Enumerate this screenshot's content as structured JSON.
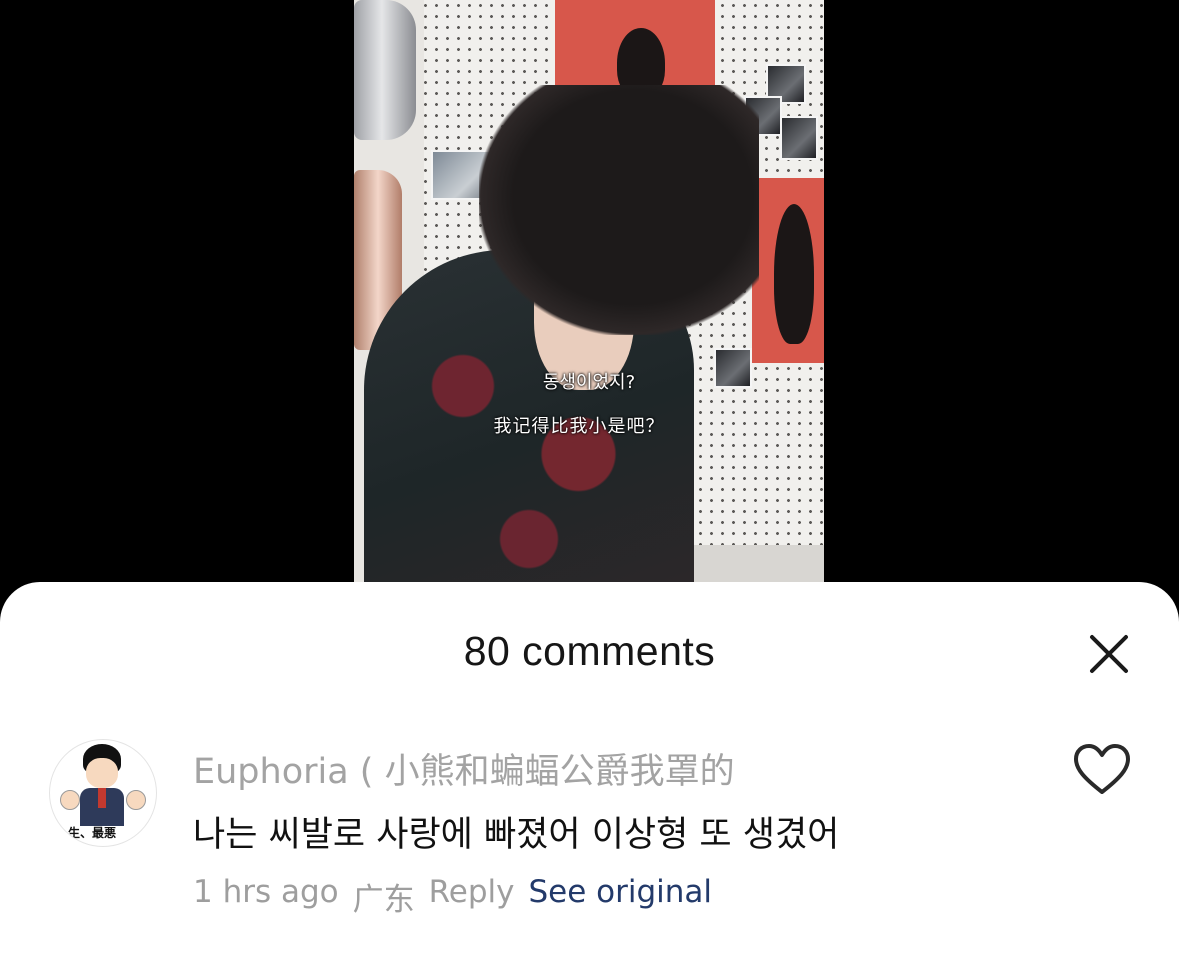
{
  "video": {
    "subtitle_korean": "동생이었지?",
    "subtitle_chinese": "我记得比我小是吧？"
  },
  "comments_sheet": {
    "title": "80 comments",
    "close_icon": "close-icon"
  },
  "comment": {
    "avatar_caption": "生、最悪",
    "username": "Euphoria ( 小熊和蝙蝠公爵我罩的",
    "text": "나는 씨발로 사랑에 빠졌어 이상형 또 생겼어",
    "time": "1 hrs ago",
    "location": "广东",
    "reply_label": "Reply",
    "see_original_label": "See original",
    "like_icon": "heart-outline-icon"
  },
  "colors": {
    "sheet_background": "#ffffff",
    "username": "#a3a3a3",
    "meta": "#9e9e9e",
    "link": "#233a6a",
    "overlay_background": "#000000"
  }
}
